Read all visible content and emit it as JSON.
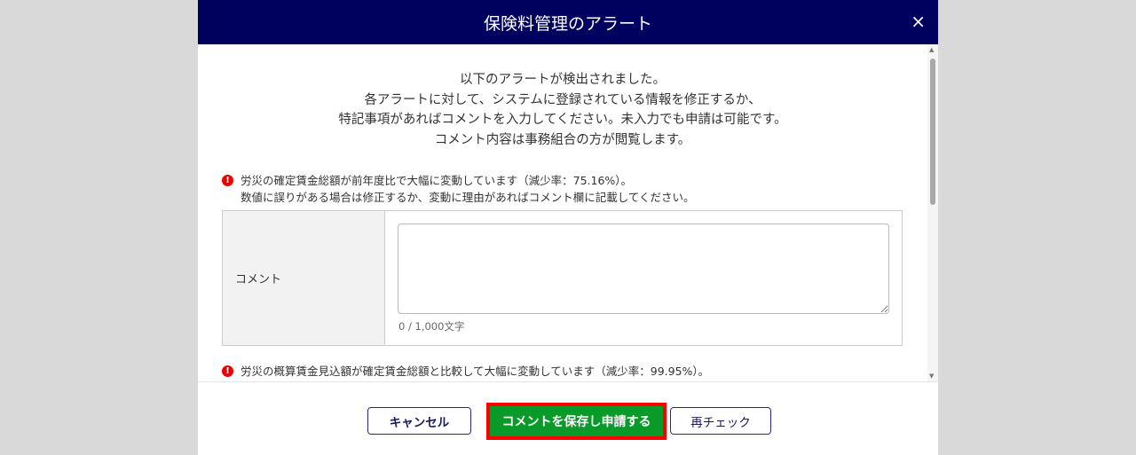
{
  "dialog": {
    "title": "保険料管理のアラート",
    "close_icon": "×"
  },
  "intro": [
    "以下のアラートが検出されました。",
    "各アラートに対して、システムに登録されている情報を修正するか、",
    "特記事項があればコメントを入力してください。未入力でも申請は可能です。",
    "コメント内容は事務組合の方が閲覧します。"
  ],
  "alerts": [
    {
      "line1": "労災の確定賃金総額が前年度比で大幅に変動しています（減少率：75.16%）。",
      "line2": "数値に誤りがある場合は修正するか、変動に理由があればコメント欄に記載してください。"
    },
    {
      "line1": "労災の概算賃金見込額が確定賃金総額と比較して大幅に変動しています（減少率：99.95%）。"
    }
  ],
  "comment": {
    "label": "コメント",
    "value": "",
    "counter": "0 / 1,000文字"
  },
  "footer": {
    "cancel": "キャンセル",
    "save": "コメントを保存し申請する",
    "recheck": "再チェック"
  },
  "colors": {
    "header": "#00005e",
    "save": "#0a9a2a",
    "highlight": "#ff0000"
  }
}
